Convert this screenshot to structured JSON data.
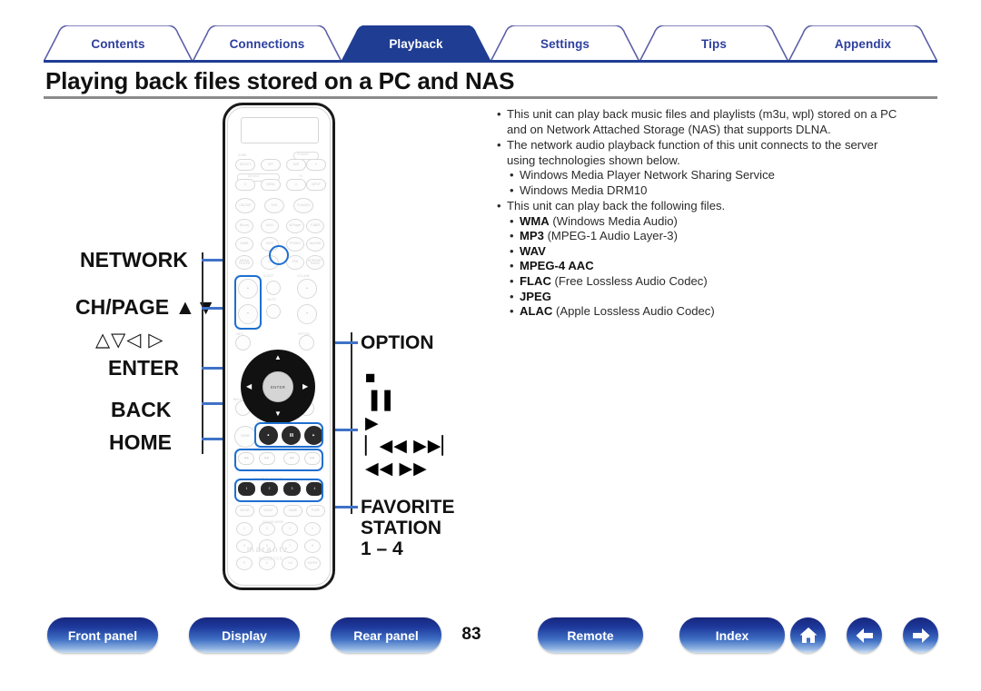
{
  "tabs": [
    {
      "label": "Contents",
      "active": false
    },
    {
      "label": "Connections",
      "active": false
    },
    {
      "label": "Playback",
      "active": true
    },
    {
      "label": "Settings",
      "active": false
    },
    {
      "label": "Tips",
      "active": false
    },
    {
      "label": "Appendix",
      "active": false
    }
  ],
  "page_title": "Playing back files stored on a PC and NAS",
  "notes": {
    "b1_line1": "This unit can play back music files and playlists (m3u, wpl) stored on a PC",
    "b1_line2": "and on Network Attached Storage (NAS) that supports DLNA.",
    "b2_line1": "The network audio playback function of this unit connects to the server",
    "b2_line2": "using technologies shown below.",
    "b2_sub1": "Windows Media Player Network Sharing Service",
    "b2_sub2": "Windows Media DRM10",
    "b3_line1": "This unit can play back the following files.",
    "formats": [
      {
        "name": "WMA",
        "desc": " (Windows Media Audio)"
      },
      {
        "name": "MP3",
        "desc": " (MPEG-1 Audio Layer-3)"
      },
      {
        "name": "WAV",
        "desc": ""
      },
      {
        "name": "MPEG-4 AAC",
        "desc": ""
      },
      {
        "name": "FLAC",
        "desc": " (Free Lossless Audio Codec)"
      },
      {
        "name": "JPEG",
        "desc": ""
      },
      {
        "name": "ALAC",
        "desc": " (Apple Lossless Audio Codec)"
      }
    ]
  },
  "callouts": {
    "network": "NETWORK",
    "chpage": "CH/PAGE ▲▼",
    "cursor_arrows": "△▽◁ ▷",
    "enter": "ENTER",
    "back": "BACK",
    "home": "HOME",
    "option": "OPTION",
    "favorite_l1": "FAVORITE",
    "favorite_l2": "STATION",
    "favorite_l3": "1 – 4",
    "transport": [
      "■",
      "▐▐",
      "▶",
      "▏◀◀ ▶▶▏",
      "◀◀ ▶▶"
    ]
  },
  "remote": {
    "brand": "marantz",
    "model": "RC023SR",
    "group_labels": {
      "zone": "ZONE",
      "power": "POWER",
      "device": "DEVICE",
      "tv": "TV",
      "chpage": "CH/PAGE",
      "sleep": "SLEEP",
      "volume": "VOLUME",
      "mute": "MUTE",
      "info": "INFO",
      "option": "OPTION",
      "setup": "SETUP",
      "back": "BACK",
      "device_control": "DEVICE CONTROL",
      "tune": "−  TUNE  +",
      "favorite_station": "FAVORITE STATION",
      "sound_mode": "SOUND MODE",
      "enter": "ENTER"
    },
    "keys_row_zone": [
      "SELECT",
      "SET",
      "AVR",
      "⏻"
    ],
    "keys_row_device": [
      "⏻",
      "MENU",
      "⏻",
      "INPUT"
    ],
    "keys_row_src1": [
      "CBL/SAT",
      "DVD",
      "TV AUDIO"
    ],
    "keys_row_src2": [
      "Blu-ray",
      "AUX1",
      "M-Player",
      "TUNER"
    ],
    "keys_row_src3": [
      "GAME",
      "AUX2",
      "PHONO",
      "Net/USB"
    ],
    "keys_row_src4": [
      "MEDIA PLAYER",
      "CD",
      "iPod",
      "INTERNET RADIO"
    ],
    "keys_favorite": [
      "1",
      "2",
      "3",
      "4"
    ],
    "keys_mode": [
      "MOVIE",
      "MUSIC",
      "GAME",
      "PURE"
    ],
    "keys_numeric": [
      "1",
      "2",
      "3",
      "4",
      "5",
      "6",
      "7",
      "8",
      "9",
      "0",
      "+10",
      "ENTER"
    ]
  },
  "footer": {
    "buttons": [
      {
        "label": "Front panel"
      },
      {
        "label": "Display"
      },
      {
        "label": "Rear panel"
      },
      {
        "label": "Remote"
      },
      {
        "label": "Index"
      }
    ],
    "page_number": "83",
    "icons": [
      "home-icon",
      "back-arrow-icon",
      "forward-arrow-icon"
    ]
  },
  "colors": {
    "tab_active_bg": "#1f3d93",
    "tab_inactive_text": "#2d3f9e",
    "rule": "#1f3d93",
    "title_rule": "#8b8b8b",
    "callout_line": "#3f72c6",
    "footer_button": "#1e3a9c"
  }
}
